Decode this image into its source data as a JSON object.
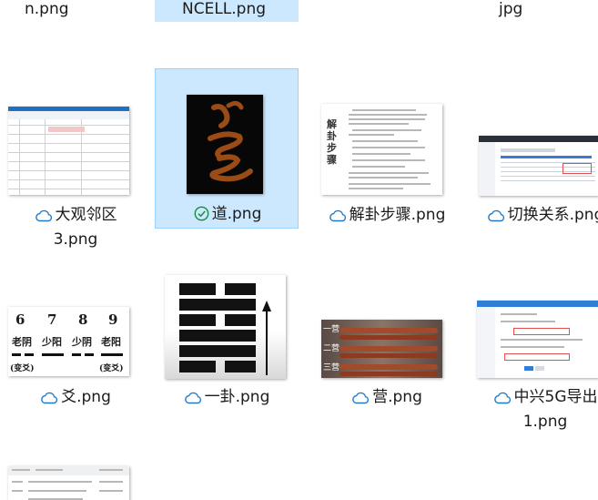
{
  "top_row": {
    "left_label": "n.png",
    "middle_label": "NCELL.png",
    "right_label": "jpg"
  },
  "files": [
    {
      "name_line1": "大观邻区",
      "name_line2": "3.png",
      "status": "cloud-icon"
    },
    {
      "name_line1": "道.png",
      "name_line2": "",
      "status": "check-circle-icon",
      "selected": true
    },
    {
      "name_line1": "解卦步骤.png",
      "name_line2": "",
      "status": "cloud-icon"
    },
    {
      "name_line1": "切换关系.png",
      "name_line2": "",
      "status": "cloud-icon"
    },
    {
      "name_line1": "爻.png",
      "name_line2": "",
      "status": "cloud-icon"
    },
    {
      "name_line1": "一卦.png",
      "name_line2": "",
      "status": "cloud-icon"
    },
    {
      "name_line1": "营.png",
      "name_line2": "",
      "status": "cloud-icon"
    },
    {
      "name_line1": "中兴5G导出",
      "name_line2": "1.png",
      "status": "cloud-icon"
    }
  ],
  "thumb_text": {
    "yao_numbers": [
      "6",
      "7",
      "8",
      "9"
    ],
    "yao_names": [
      "老阴",
      "少阳",
      "少阴",
      "老阳"
    ],
    "yao_change_left": "(变爻)",
    "yao_change_right": "(变爻)",
    "jiegua_vertical": "解卦步骤",
    "ying_labels": [
      "一营",
      "二营",
      "三营"
    ],
    "dao_glyph": "道"
  },
  "colors": {
    "selection_fill": "#cce8ff",
    "selection_border": "#99d1ff",
    "cloud_stroke": "#1e78c8",
    "check_stroke": "#1a8a3c",
    "calligraphy": "#9a4b16"
  }
}
